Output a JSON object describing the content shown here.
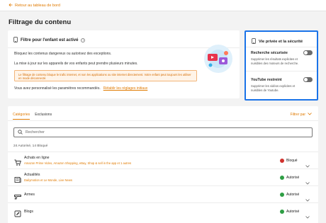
{
  "header": {
    "back_label": "Retour au tableau de bord"
  },
  "page": {
    "title": "Filtrage du contenu"
  },
  "filter_card": {
    "title": "Filtre pour l'enfant est activé",
    "text1": "Bloquez les contenus dangereux ou autorisez des exceptions.",
    "text2": "La mise à jour sur les appareils de vos enfants peut prendre plusieurs minutes.",
    "warning": "Le filtrage de contenu bloque le trafic internet, et non les applications ou site internet directement. Votre enfant peut toujours les utiliser en mode déconnecté.",
    "rec_text": "Vous avez personnalisé les paramètres recommandés.",
    "rec_link": "Rétablir les réglages initiaux"
  },
  "privacy": {
    "title": "Vie privée et la sécurité",
    "items": [
      {
        "title": "Recherche sécurisée",
        "desc": "Supprimer les résultats explicites et nuisibles des moteurs de recherche.",
        "enabled": false
      },
      {
        "title": "YouTube restreint",
        "desc": "Supprimer les vidéos explicites et nuisibles de Youtube.",
        "enabled": false
      }
    ]
  },
  "list": {
    "tabs": [
      {
        "label": "Catégories",
        "active": true
      },
      {
        "label": "Exclusions",
        "active": false
      }
    ],
    "filter_label": "Filtrer par",
    "search_placeholder": "Rechercher",
    "counts": "24 Autorisé, 14 Bloqué",
    "rows": [
      {
        "title": "Achats en ligne",
        "subtitle": "Amazon Prime Video, Amazon Shopping, eBay, Shop & sell in the app et 1 autres",
        "status": "Bloqué",
        "icon": "cart-icon"
      },
      {
        "title": "Actualités",
        "subtitle": "Dailymotion et Le Monde, Live News",
        "status": "Autorisé",
        "icon": "news-icon"
      },
      {
        "title": "Armes",
        "subtitle": "",
        "status": "Autorisé",
        "icon": "weapon-icon"
      },
      {
        "title": "Blogs",
        "subtitle": "",
        "status": "Autorisé",
        "icon": "blog-icon"
      }
    ]
  },
  "colors": {
    "accent": "#e07a00",
    "blocked": "#d0312d",
    "allowed": "#2e9e44",
    "highlight": "#1a73e8"
  }
}
